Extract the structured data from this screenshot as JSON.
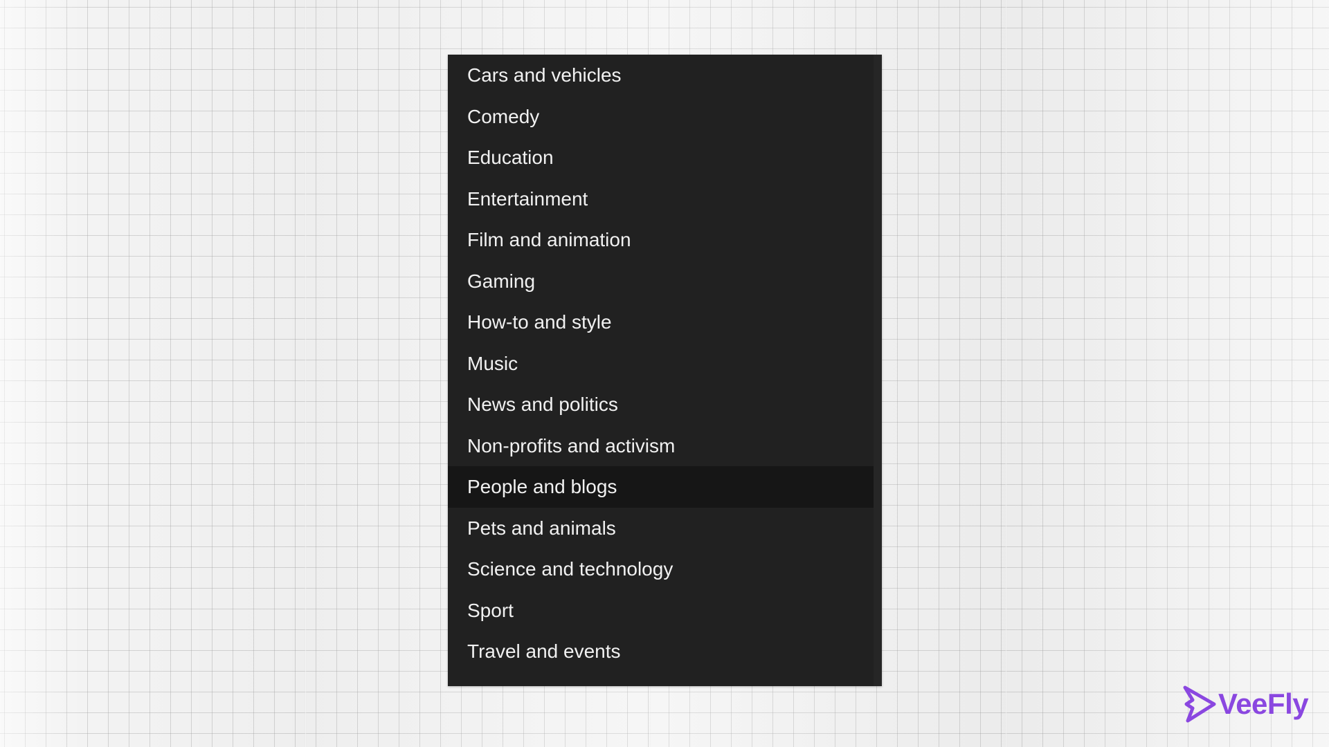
{
  "category_menu": {
    "selected_index": 10,
    "items": [
      {
        "label": "Cars and vehicles"
      },
      {
        "label": "Comedy"
      },
      {
        "label": "Education"
      },
      {
        "label": "Entertainment"
      },
      {
        "label": "Film and animation"
      },
      {
        "label": "Gaming"
      },
      {
        "label": "How-to and style"
      },
      {
        "label": "Music"
      },
      {
        "label": "News and politics"
      },
      {
        "label": "Non-profits and activism"
      },
      {
        "label": "People and blogs"
      },
      {
        "label": "Pets and animals"
      },
      {
        "label": "Science and technology"
      },
      {
        "label": "Sport"
      },
      {
        "label": "Travel and events"
      }
    ]
  },
  "watermark": {
    "brand": "VeeFly",
    "icon": "veefly-logo-icon",
    "color": "#8a47e0"
  },
  "colors": {
    "menu_background": "#212121",
    "menu_selected_background": "#161616",
    "menu_text": "#f1f1f1"
  }
}
